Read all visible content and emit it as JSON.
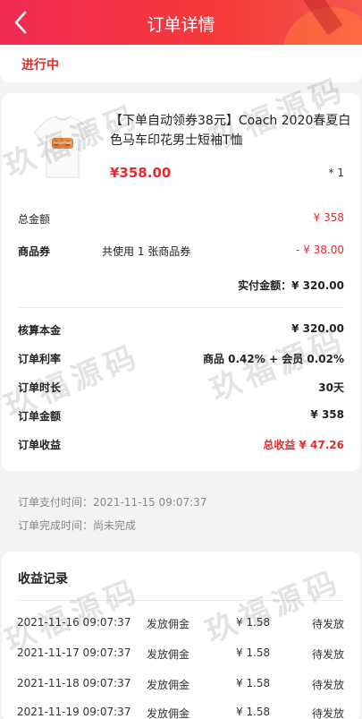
{
  "header": {
    "title": "订单详情"
  },
  "status": {
    "text": "进行中"
  },
  "product": {
    "title": "【下单自动领券38元】Coach 2020春夏白色马车印花男士短袖T恤",
    "price": "¥358.00",
    "quantity": "* 1"
  },
  "summary": {
    "total_label": "总金额",
    "total_value": "¥ 358",
    "coupon_label": "商品券",
    "coupon_desc": "共使用 1 张商品券",
    "coupon_value": "- ¥ 38.00",
    "paid": "实付金额：¥ 320.00"
  },
  "details": [
    {
      "label": "核算本金",
      "value": "¥ 320.00"
    },
    {
      "label": "订单利率",
      "value": "商品 0.42% + 会员 0.02%"
    },
    {
      "label": "订单时长",
      "value": "30天"
    },
    {
      "label": "订单金额",
      "value": "¥ 358"
    },
    {
      "label": "订单收益",
      "value": "总收益 ¥ 47.26"
    }
  ],
  "times": {
    "pay_time": "订单支付时间：2021-11-15 09:07:37",
    "finish_time": "订单完成时间：尚未完成"
  },
  "income": {
    "title": "收益记录",
    "records": [
      {
        "time": "2021-11-16 09:07:37",
        "type": "发放佣金",
        "amount": "¥ 1.58",
        "status": "待发放"
      },
      {
        "time": "2021-11-17 09:07:37",
        "type": "发放佣金",
        "amount": "¥ 1.58",
        "status": "待发放"
      },
      {
        "time": "2021-11-18 09:07:37",
        "type": "发放佣金",
        "amount": "¥ 1.58",
        "status": "待发放"
      },
      {
        "time": "2021-11-19 09:07:37",
        "type": "发放佣金",
        "amount": "¥ 1.58",
        "status": "待发放"
      }
    ]
  },
  "watermark": "玖福源码",
  "colors": {
    "accent": "#e8292d",
    "header_start": "#ef2a52",
    "header_end": "#f5564c"
  }
}
